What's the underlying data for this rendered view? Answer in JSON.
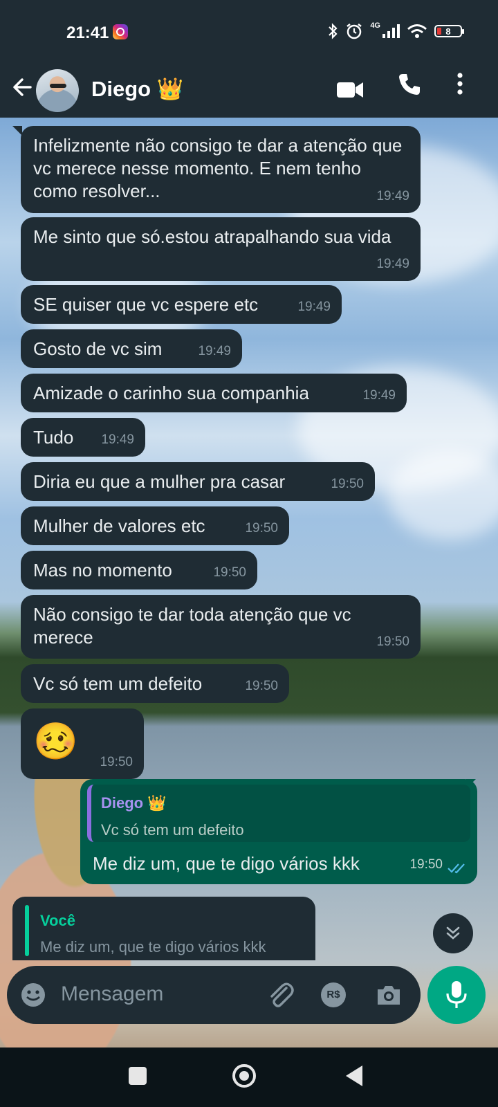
{
  "status_bar": {
    "time": "21:41",
    "network": "4G",
    "battery": "8"
  },
  "header": {
    "contact_name": "Diego",
    "contact_badge": "👑"
  },
  "messages": [
    {
      "text": "Infelizmente não consigo te dar  a atenção que vc merece nesse momento. E nem tenho como resolver...",
      "time": "19:49"
    },
    {
      "text": "Me sinto que só.estou atrapalhando sua vida",
      "time": "19:49"
    },
    {
      "text": "SE quiser que vc espere etc",
      "time": "19:49"
    },
    {
      "text": "Gosto de vc sim",
      "time": "19:49"
    },
    {
      "text": "Amizade o carinho sua companhia",
      "time": "19:49"
    },
    {
      "text": "Tudo",
      "time": "19:49"
    },
    {
      "text": "Diria eu que a mulher pra casar",
      "time": "19:50"
    },
    {
      "text": "Mulher de valores etc",
      "time": "19:50"
    },
    {
      "text": "Mas no momento",
      "time": "19:50"
    },
    {
      "text": "Não consigo te dar toda atenção que vc merece",
      "time": "19:50"
    },
    {
      "text": "Vc só tem um defeito",
      "time": "19:50"
    },
    {
      "text": "🥴",
      "time": "19:50"
    }
  ],
  "outgoing": {
    "quote_name": "Diego 👑",
    "quote_text": "Vc só tem um defeito",
    "text": "Me diz um, que te digo vários kkk",
    "time": "19:50"
  },
  "reply_preview": {
    "quote_name": "Você",
    "quote_text": "Me diz um, que te digo vários kkk"
  },
  "composer": {
    "placeholder": "Mensagem"
  },
  "colors": {
    "header_bg": "#1f2c34",
    "incoming_bubble": "#1f2c34",
    "outgoing_bubble": "#005c4b",
    "accent_green": "#00a884",
    "read_ticks": "#53bdeb"
  }
}
